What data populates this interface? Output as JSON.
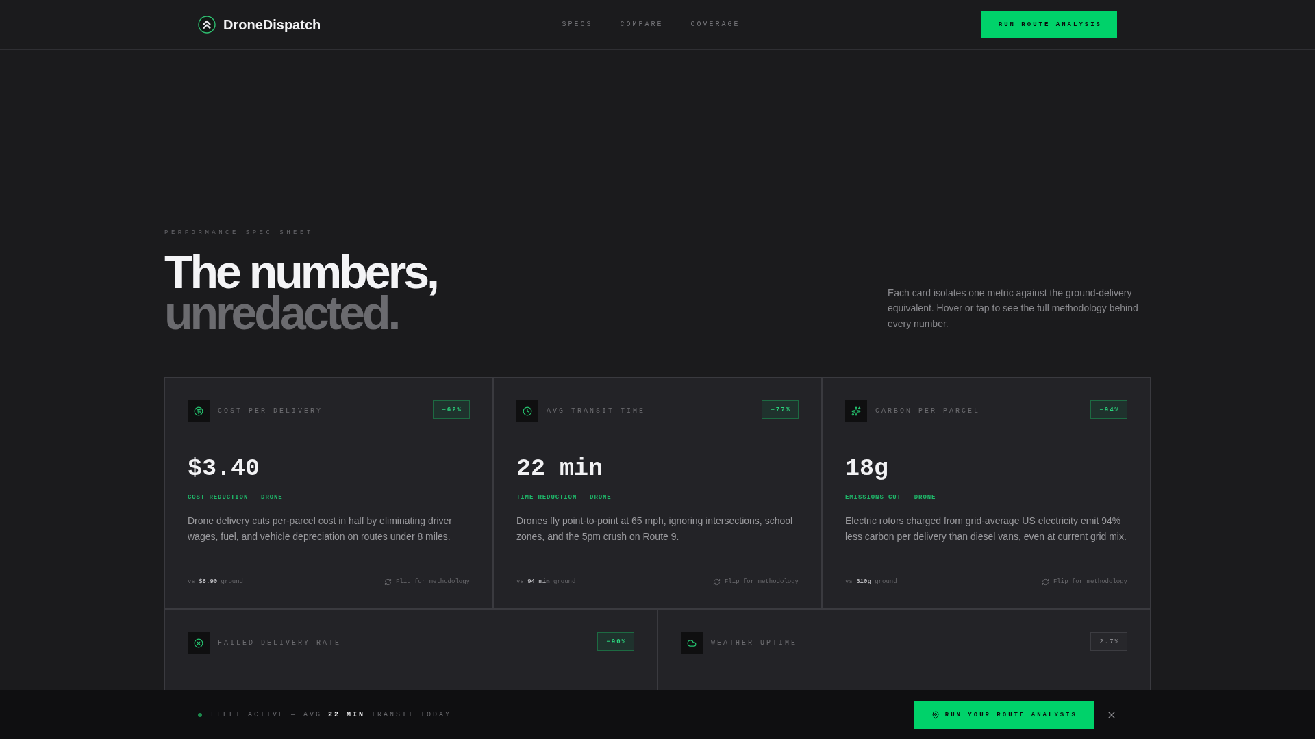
{
  "header": {
    "brand": "DroneDispatch",
    "nav": [
      {
        "label": "SPECS"
      },
      {
        "label": "COMPARE"
      },
      {
        "label": "COVERAGE"
      }
    ],
    "cta": "RUN ROUTE ANALYSIS"
  },
  "hero": {
    "eyebrow": "PERFORMANCE SPEC SHEET",
    "title": "The numbers,",
    "title_accent": "unredacted.",
    "intro": "Each card isolates one metric against the ground-delivery equivalent. Hover or tap to see the full methodology behind every number."
  },
  "card_rows": [
    {
      "cards": [
        {
          "label": "COST PER DELIVERY",
          "badge": {
            "text": "−62%",
            "kind": "positive"
          },
          "value": "$3.40",
          "tagline": "COST REDUCTION — DRONE",
          "description": "Drone delivery cuts per-parcel cost in half by eliminating driver wages, fuel, and vehicle depreciation on routes under 8 miles.",
          "comparison": "vs **$8.90** ground",
          "flip_link": "Flip for methodology"
        },
        {
          "label": "AVG TRANSIT TIME",
          "badge": {
            "text": "−77%",
            "kind": "positive"
          },
          "value": "22 min",
          "tagline": "TIME REDUCTION — DRONE",
          "description": "Drones fly point-to-point at 65 mph, ignoring intersections, school zones, and the 5pm crush on Route 9.",
          "comparison": "vs **94 min** ground",
          "flip_link": "Flip for methodology"
        },
        {
          "label": "CARBON PER PARCEL",
          "badge": {
            "text": "−94%",
            "kind": "positive"
          },
          "value": "18g",
          "tagline": "EMISSIONS CUT — DRONE",
          "description": "Electric rotors charged from grid-average US electricity emit 94% less carbon per delivery than diesel vans, even at current grid mix.",
          "comparison": "vs **310g** ground",
          "flip_link": "Flip for methodology"
        }
      ]
    },
    {
      "cards": [
        {
          "label": "FAILED DELIVERY RATE",
          "badge": {
            "text": "−90%",
            "kind": "positive"
          }
        },
        {
          "label": "WEATHER UPTIME",
          "badge": {
            "text": "2.7%",
            "kind": "neutral"
          }
        }
      ]
    }
  ],
  "status_bar": {
    "text": "FLEET ACTIVE — AVG **22 MIN** TRANSIT TODAY",
    "cta": "RUN YOUR ROUTE ANALYSIS"
  }
}
